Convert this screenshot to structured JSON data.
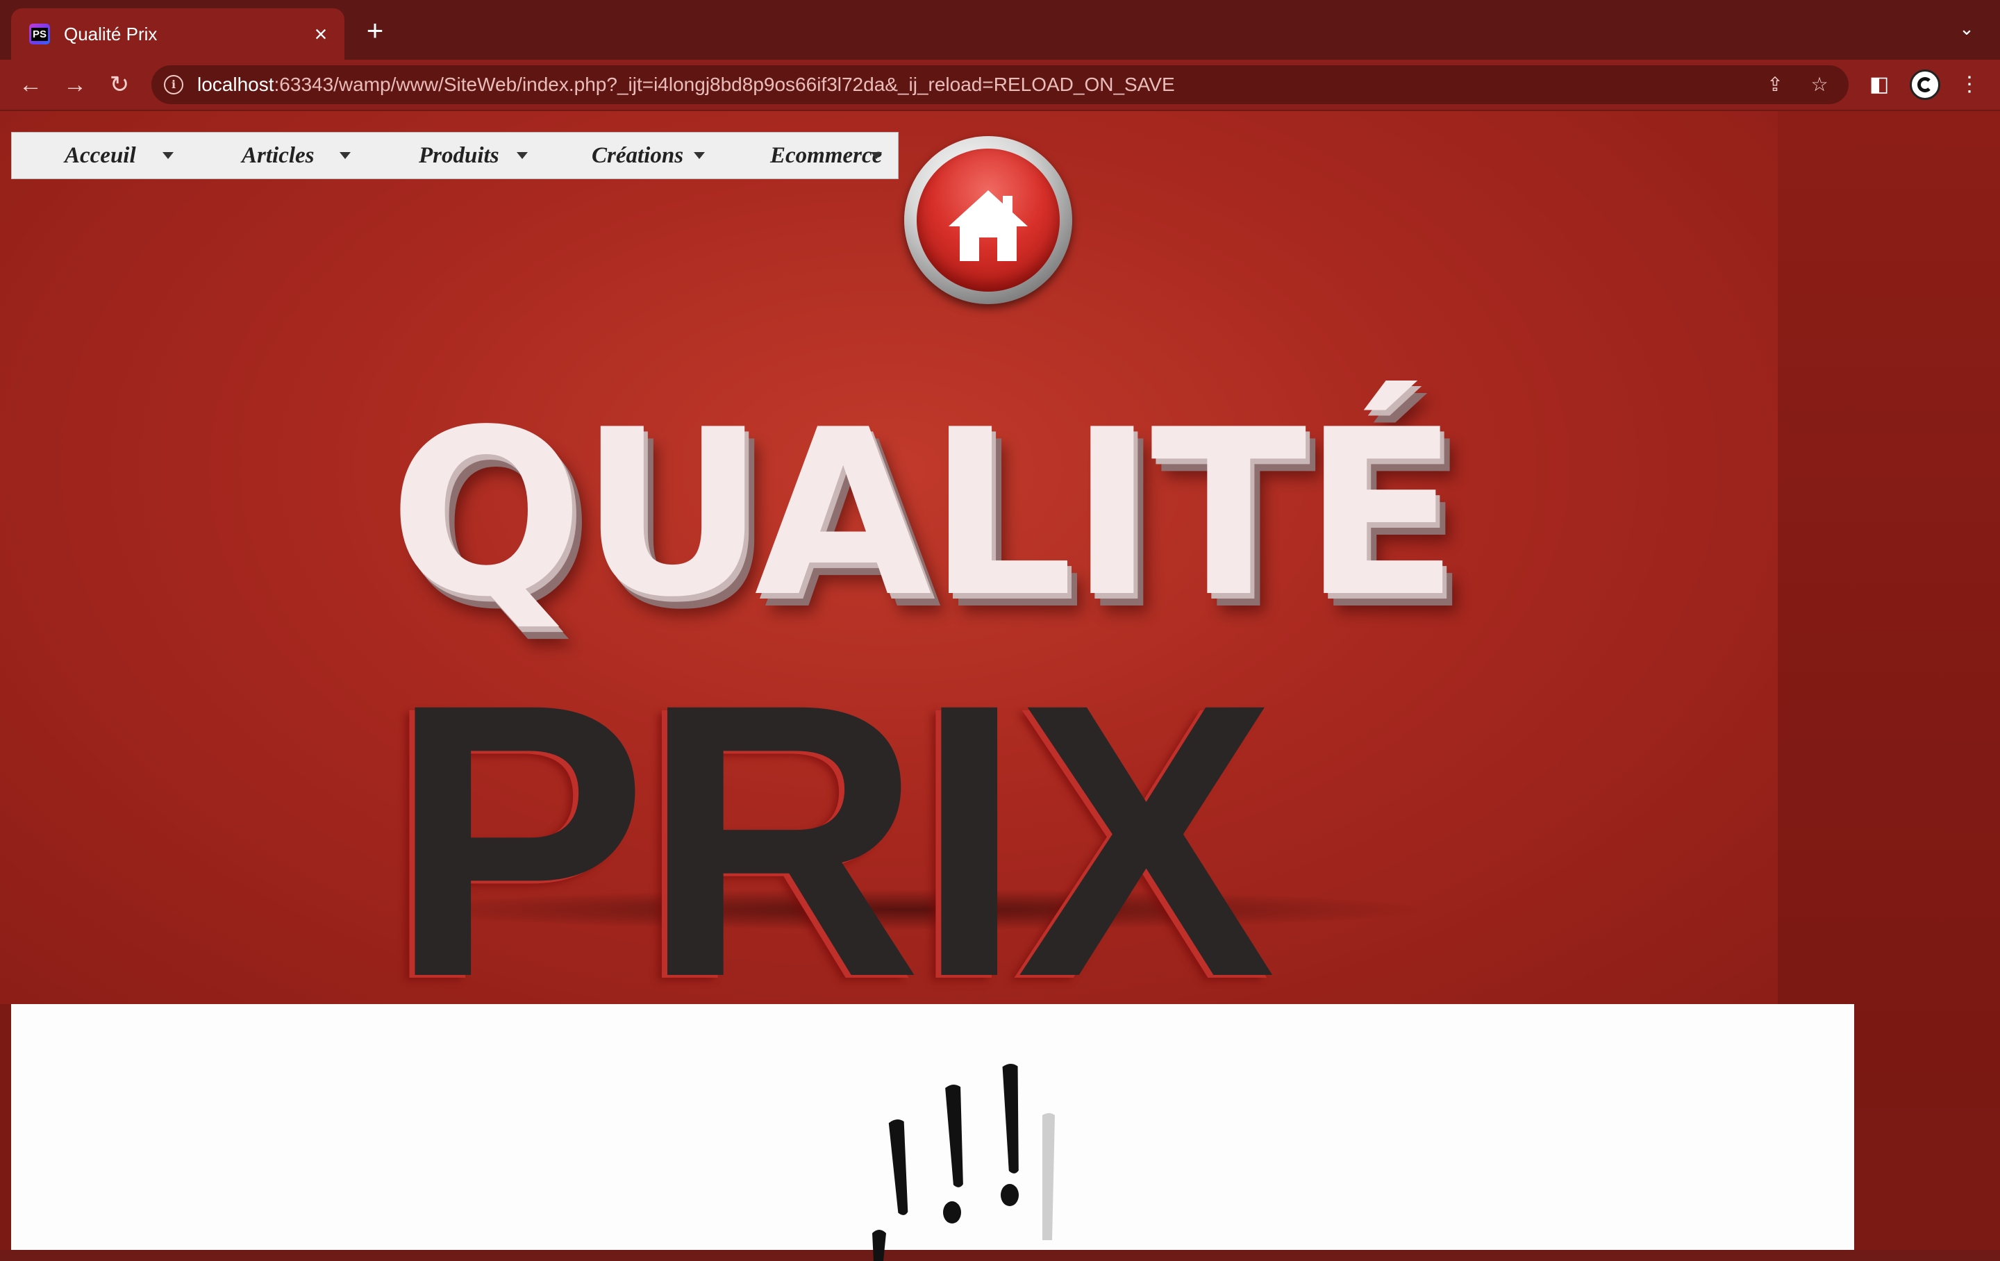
{
  "browser": {
    "tab": {
      "title": "Qualité Prix",
      "favicon": "phpstorm-icon",
      "close_symbol": "×"
    },
    "new_tab_symbol": "+",
    "url": {
      "host": "localhost",
      "rest": ":63343/wamp/www/SiteWeb/index.php?_ijt=i4longj8bd8p9os66if3l72da&_ij_reload=RELOAD_ON_SAVE"
    },
    "theme_color": "#8a1f1b"
  },
  "nav_menu": {
    "items": [
      {
        "label": "Acceuil"
      },
      {
        "label": "Articles"
      },
      {
        "label": "Produits"
      },
      {
        "label": "Créations"
      },
      {
        "label": "Ecommerce"
      }
    ]
  },
  "hero": {
    "line1": "QUALITÉ",
    "line2": "PRIX",
    "background_color": "#a8281f"
  },
  "home_button": {
    "icon": "home-icon"
  }
}
